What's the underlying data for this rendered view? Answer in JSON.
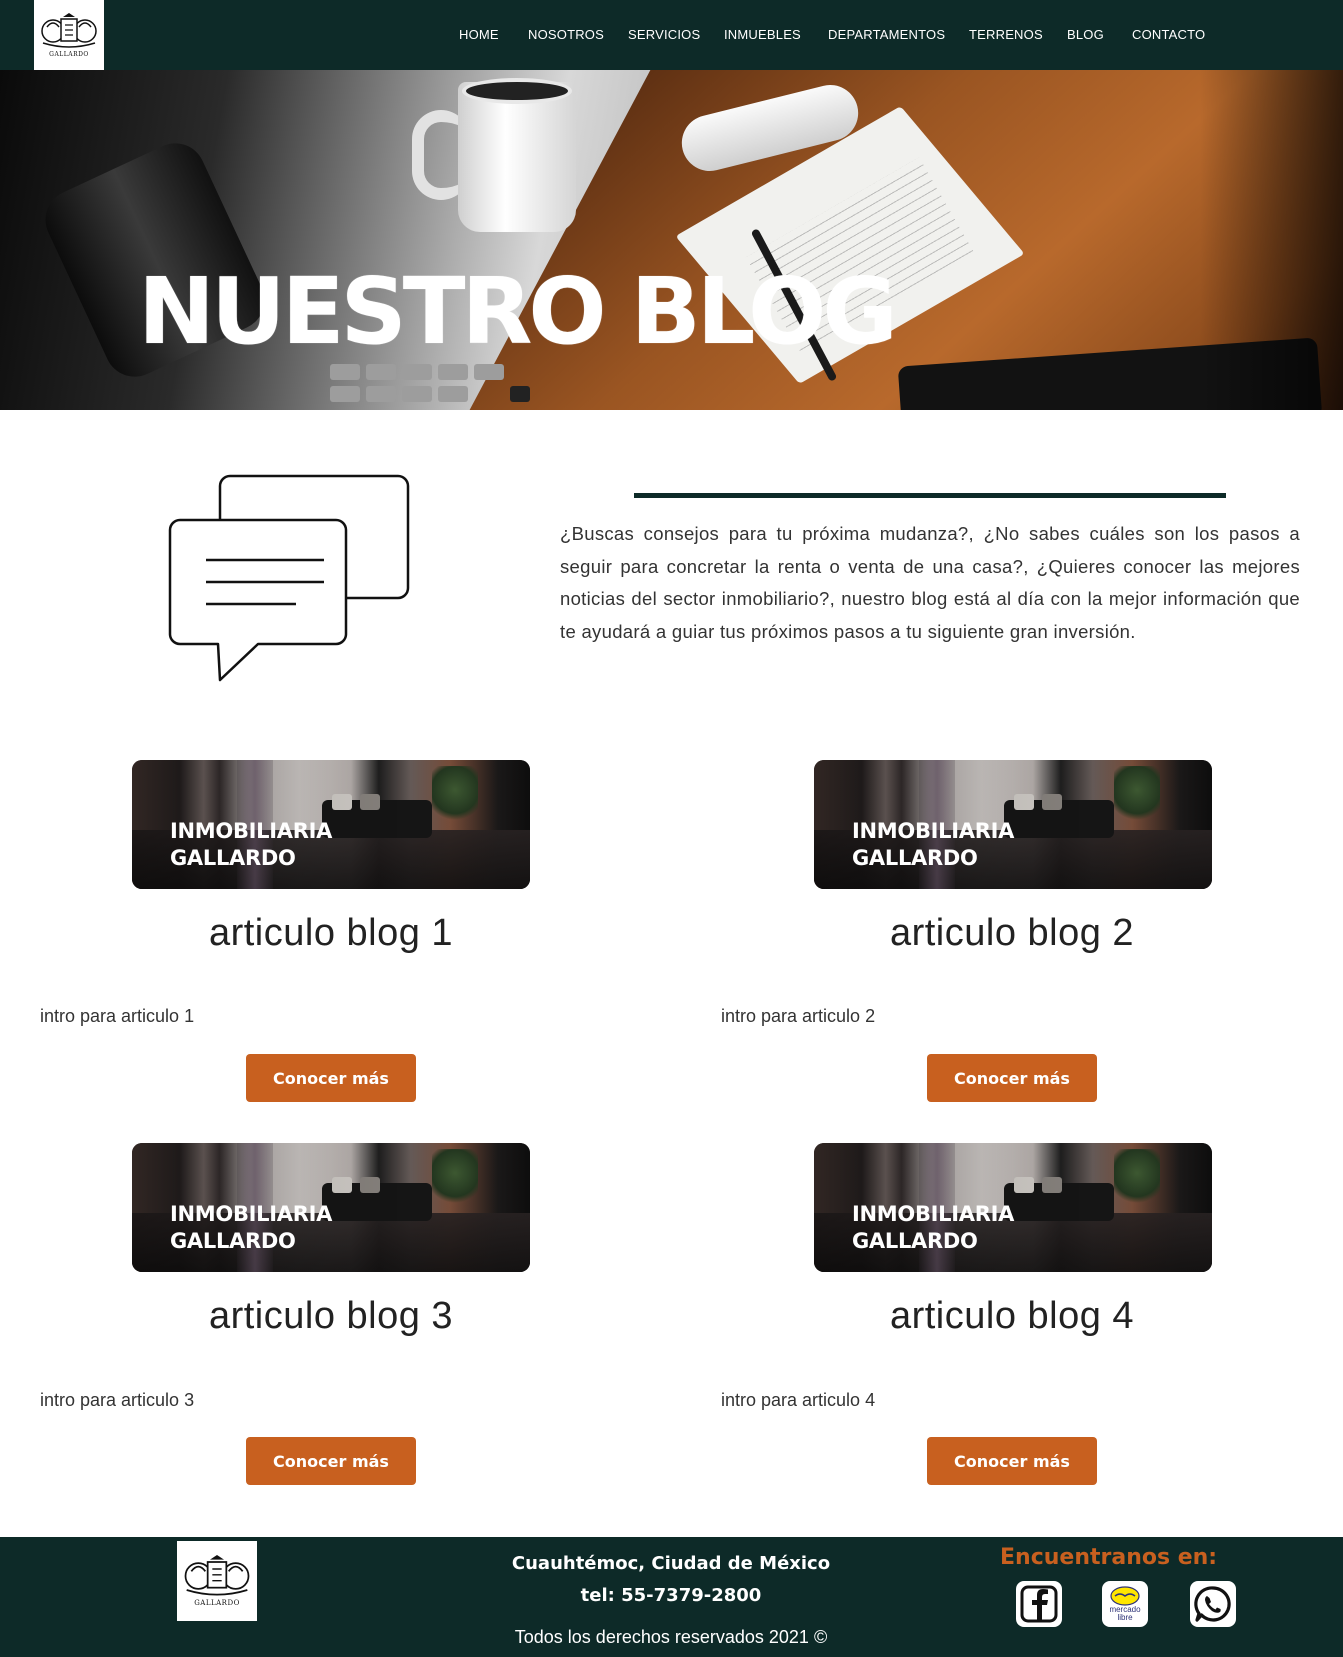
{
  "header": {
    "logo_text": "GALLARDO",
    "nav": [
      {
        "label": "HOME"
      },
      {
        "label": "NOSOTROS"
      },
      {
        "label": "SERVICIOS"
      },
      {
        "label": "INMUEBLES"
      },
      {
        "label": "DEPARTAMENTOS"
      },
      {
        "label": "TERRENOS"
      },
      {
        "label": "BLOG"
      },
      {
        "label": "CONTACTO"
      }
    ]
  },
  "hero": {
    "title": "NUESTRO BLOG"
  },
  "intro": {
    "icon": "chat-bubbles-icon",
    "text": "¿Buscas consejos para tu próxima mudanza?, ¿No sabes cuáles son los pasos a seguir para concretar la renta o venta de una casa?, ¿Quieres conocer las mejores noticias del sector inmobiliario?, nuestro blog está al día con la mejor información que te ayudará a guiar tus próximos pasos a tu siguiente gran inversión."
  },
  "articles": [
    {
      "badge_line1": "INMOBILIARIA",
      "badge_line2": "GALLARDO",
      "title": "articulo blog 1",
      "intro": "intro para articulo 1",
      "button": "Conocer más"
    },
    {
      "badge_line1": "INMOBILIARIA",
      "badge_line2": "GALLARDO",
      "title": "articulo blog 2",
      "intro": "intro para articulo 2",
      "button": "Conocer más"
    },
    {
      "badge_line1": "INMOBILIARIA",
      "badge_line2": "GALLARDO",
      "title": "articulo blog 3",
      "intro": "intro para articulo 3",
      "button": "Conocer más"
    },
    {
      "badge_line1": "INMOBILIARIA",
      "badge_line2": "GALLARDO",
      "title": "articulo blog 4",
      "intro": "intro para articulo 4",
      "button": "Conocer más"
    }
  ],
  "footer": {
    "logo_text": "GALLARDO",
    "address": "Cuauhtémoc, Ciudad de México",
    "phone": "tel: 55-7379-2800",
    "copyright": "Todos los derechos reservados 2021 ©",
    "find_us": "Encuentranos en:",
    "social": [
      {
        "icon": "facebook-icon"
      },
      {
        "icon": "mercado-libre-icon",
        "label_line1": "mercado",
        "label_line2": "libre"
      },
      {
        "icon": "whatsapp-icon"
      }
    ]
  },
  "colors": {
    "primary_dark": "#0d2a28",
    "accent_orange": "#c8601f",
    "white": "#ffffff"
  }
}
